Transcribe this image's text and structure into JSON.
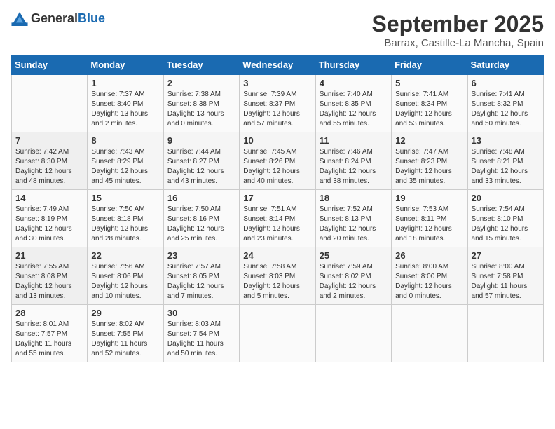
{
  "logo": {
    "text_general": "General",
    "text_blue": "Blue"
  },
  "title": "September 2025",
  "location": "Barrax, Castille-La Mancha, Spain",
  "headers": [
    "Sunday",
    "Monday",
    "Tuesday",
    "Wednesday",
    "Thursday",
    "Friday",
    "Saturday"
  ],
  "weeks": [
    [
      {
        "day": "",
        "info": ""
      },
      {
        "day": "1",
        "info": "Sunrise: 7:37 AM\nSunset: 8:40 PM\nDaylight: 13 hours\nand 2 minutes."
      },
      {
        "day": "2",
        "info": "Sunrise: 7:38 AM\nSunset: 8:38 PM\nDaylight: 13 hours\nand 0 minutes."
      },
      {
        "day": "3",
        "info": "Sunrise: 7:39 AM\nSunset: 8:37 PM\nDaylight: 12 hours\nand 57 minutes."
      },
      {
        "day": "4",
        "info": "Sunrise: 7:40 AM\nSunset: 8:35 PM\nDaylight: 12 hours\nand 55 minutes."
      },
      {
        "day": "5",
        "info": "Sunrise: 7:41 AM\nSunset: 8:34 PM\nDaylight: 12 hours\nand 53 minutes."
      },
      {
        "day": "6",
        "info": "Sunrise: 7:41 AM\nSunset: 8:32 PM\nDaylight: 12 hours\nand 50 minutes."
      }
    ],
    [
      {
        "day": "7",
        "info": "Sunrise: 7:42 AM\nSunset: 8:30 PM\nDaylight: 12 hours\nand 48 minutes."
      },
      {
        "day": "8",
        "info": "Sunrise: 7:43 AM\nSunset: 8:29 PM\nDaylight: 12 hours\nand 45 minutes."
      },
      {
        "day": "9",
        "info": "Sunrise: 7:44 AM\nSunset: 8:27 PM\nDaylight: 12 hours\nand 43 minutes."
      },
      {
        "day": "10",
        "info": "Sunrise: 7:45 AM\nSunset: 8:26 PM\nDaylight: 12 hours\nand 40 minutes."
      },
      {
        "day": "11",
        "info": "Sunrise: 7:46 AM\nSunset: 8:24 PM\nDaylight: 12 hours\nand 38 minutes."
      },
      {
        "day": "12",
        "info": "Sunrise: 7:47 AM\nSunset: 8:23 PM\nDaylight: 12 hours\nand 35 minutes."
      },
      {
        "day": "13",
        "info": "Sunrise: 7:48 AM\nSunset: 8:21 PM\nDaylight: 12 hours\nand 33 minutes."
      }
    ],
    [
      {
        "day": "14",
        "info": "Sunrise: 7:49 AM\nSunset: 8:19 PM\nDaylight: 12 hours\nand 30 minutes."
      },
      {
        "day": "15",
        "info": "Sunrise: 7:50 AM\nSunset: 8:18 PM\nDaylight: 12 hours\nand 28 minutes."
      },
      {
        "day": "16",
        "info": "Sunrise: 7:50 AM\nSunset: 8:16 PM\nDaylight: 12 hours\nand 25 minutes."
      },
      {
        "day": "17",
        "info": "Sunrise: 7:51 AM\nSunset: 8:14 PM\nDaylight: 12 hours\nand 23 minutes."
      },
      {
        "day": "18",
        "info": "Sunrise: 7:52 AM\nSunset: 8:13 PM\nDaylight: 12 hours\nand 20 minutes."
      },
      {
        "day": "19",
        "info": "Sunrise: 7:53 AM\nSunset: 8:11 PM\nDaylight: 12 hours\nand 18 minutes."
      },
      {
        "day": "20",
        "info": "Sunrise: 7:54 AM\nSunset: 8:10 PM\nDaylight: 12 hours\nand 15 minutes."
      }
    ],
    [
      {
        "day": "21",
        "info": "Sunrise: 7:55 AM\nSunset: 8:08 PM\nDaylight: 12 hours\nand 13 minutes."
      },
      {
        "day": "22",
        "info": "Sunrise: 7:56 AM\nSunset: 8:06 PM\nDaylight: 12 hours\nand 10 minutes."
      },
      {
        "day": "23",
        "info": "Sunrise: 7:57 AM\nSunset: 8:05 PM\nDaylight: 12 hours\nand 7 minutes."
      },
      {
        "day": "24",
        "info": "Sunrise: 7:58 AM\nSunset: 8:03 PM\nDaylight: 12 hours\nand 5 minutes."
      },
      {
        "day": "25",
        "info": "Sunrise: 7:59 AM\nSunset: 8:02 PM\nDaylight: 12 hours\nand 2 minutes."
      },
      {
        "day": "26",
        "info": "Sunrise: 8:00 AM\nSunset: 8:00 PM\nDaylight: 12 hours\nand 0 minutes."
      },
      {
        "day": "27",
        "info": "Sunrise: 8:00 AM\nSunset: 7:58 PM\nDaylight: 11 hours\nand 57 minutes."
      }
    ],
    [
      {
        "day": "28",
        "info": "Sunrise: 8:01 AM\nSunset: 7:57 PM\nDaylight: 11 hours\nand 55 minutes."
      },
      {
        "day": "29",
        "info": "Sunrise: 8:02 AM\nSunset: 7:55 PM\nDaylight: 11 hours\nand 52 minutes."
      },
      {
        "day": "30",
        "info": "Sunrise: 8:03 AM\nSunset: 7:54 PM\nDaylight: 11 hours\nand 50 minutes."
      },
      {
        "day": "",
        "info": ""
      },
      {
        "day": "",
        "info": ""
      },
      {
        "day": "",
        "info": ""
      },
      {
        "day": "",
        "info": ""
      }
    ]
  ]
}
